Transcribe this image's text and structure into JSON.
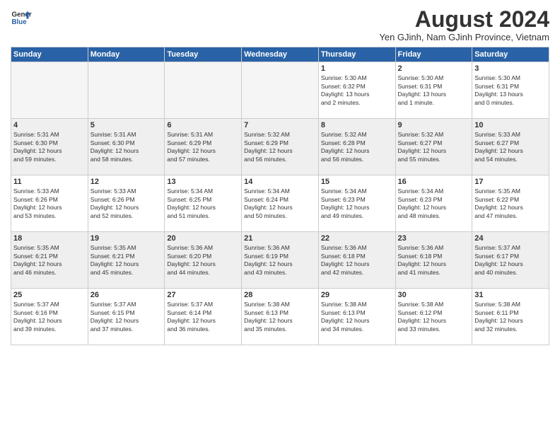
{
  "header": {
    "logo_line1": "General",
    "logo_line2": "Blue",
    "month_year": "August 2024",
    "location": "Yen GJinh, Nam GJinh Province, Vietnam"
  },
  "days_of_week": [
    "Sunday",
    "Monday",
    "Tuesday",
    "Wednesday",
    "Thursday",
    "Friday",
    "Saturday"
  ],
  "weeks": [
    [
      {
        "day": "",
        "info": ""
      },
      {
        "day": "",
        "info": ""
      },
      {
        "day": "",
        "info": ""
      },
      {
        "day": "",
        "info": ""
      },
      {
        "day": "1",
        "info": "Sunrise: 5:30 AM\nSunset: 6:32 PM\nDaylight: 13 hours\nand 2 minutes."
      },
      {
        "day": "2",
        "info": "Sunrise: 5:30 AM\nSunset: 6:31 PM\nDaylight: 13 hours\nand 1 minute."
      },
      {
        "day": "3",
        "info": "Sunrise: 5:30 AM\nSunset: 6:31 PM\nDaylight: 13 hours\nand 0 minutes."
      }
    ],
    [
      {
        "day": "4",
        "info": "Sunrise: 5:31 AM\nSunset: 6:30 PM\nDaylight: 12 hours\nand 59 minutes."
      },
      {
        "day": "5",
        "info": "Sunrise: 5:31 AM\nSunset: 6:30 PM\nDaylight: 12 hours\nand 58 minutes."
      },
      {
        "day": "6",
        "info": "Sunrise: 5:31 AM\nSunset: 6:29 PM\nDaylight: 12 hours\nand 57 minutes."
      },
      {
        "day": "7",
        "info": "Sunrise: 5:32 AM\nSunset: 6:29 PM\nDaylight: 12 hours\nand 56 minutes."
      },
      {
        "day": "8",
        "info": "Sunrise: 5:32 AM\nSunset: 6:28 PM\nDaylight: 12 hours\nand 56 minutes."
      },
      {
        "day": "9",
        "info": "Sunrise: 5:32 AM\nSunset: 6:27 PM\nDaylight: 12 hours\nand 55 minutes."
      },
      {
        "day": "10",
        "info": "Sunrise: 5:33 AM\nSunset: 6:27 PM\nDaylight: 12 hours\nand 54 minutes."
      }
    ],
    [
      {
        "day": "11",
        "info": "Sunrise: 5:33 AM\nSunset: 6:26 PM\nDaylight: 12 hours\nand 53 minutes."
      },
      {
        "day": "12",
        "info": "Sunrise: 5:33 AM\nSunset: 6:26 PM\nDaylight: 12 hours\nand 52 minutes."
      },
      {
        "day": "13",
        "info": "Sunrise: 5:34 AM\nSunset: 6:25 PM\nDaylight: 12 hours\nand 51 minutes."
      },
      {
        "day": "14",
        "info": "Sunrise: 5:34 AM\nSunset: 6:24 PM\nDaylight: 12 hours\nand 50 minutes."
      },
      {
        "day": "15",
        "info": "Sunrise: 5:34 AM\nSunset: 6:23 PM\nDaylight: 12 hours\nand 49 minutes."
      },
      {
        "day": "16",
        "info": "Sunrise: 5:34 AM\nSunset: 6:23 PM\nDaylight: 12 hours\nand 48 minutes."
      },
      {
        "day": "17",
        "info": "Sunrise: 5:35 AM\nSunset: 6:22 PM\nDaylight: 12 hours\nand 47 minutes."
      }
    ],
    [
      {
        "day": "18",
        "info": "Sunrise: 5:35 AM\nSunset: 6:21 PM\nDaylight: 12 hours\nand 46 minutes."
      },
      {
        "day": "19",
        "info": "Sunrise: 5:35 AM\nSunset: 6:21 PM\nDaylight: 12 hours\nand 45 minutes."
      },
      {
        "day": "20",
        "info": "Sunrise: 5:36 AM\nSunset: 6:20 PM\nDaylight: 12 hours\nand 44 minutes."
      },
      {
        "day": "21",
        "info": "Sunrise: 5:36 AM\nSunset: 6:19 PM\nDaylight: 12 hours\nand 43 minutes."
      },
      {
        "day": "22",
        "info": "Sunrise: 5:36 AM\nSunset: 6:18 PM\nDaylight: 12 hours\nand 42 minutes."
      },
      {
        "day": "23",
        "info": "Sunrise: 5:36 AM\nSunset: 6:18 PM\nDaylight: 12 hours\nand 41 minutes."
      },
      {
        "day": "24",
        "info": "Sunrise: 5:37 AM\nSunset: 6:17 PM\nDaylight: 12 hours\nand 40 minutes."
      }
    ],
    [
      {
        "day": "25",
        "info": "Sunrise: 5:37 AM\nSunset: 6:16 PM\nDaylight: 12 hours\nand 39 minutes."
      },
      {
        "day": "26",
        "info": "Sunrise: 5:37 AM\nSunset: 6:15 PM\nDaylight: 12 hours\nand 37 minutes."
      },
      {
        "day": "27",
        "info": "Sunrise: 5:37 AM\nSunset: 6:14 PM\nDaylight: 12 hours\nand 36 minutes."
      },
      {
        "day": "28",
        "info": "Sunrise: 5:38 AM\nSunset: 6:13 PM\nDaylight: 12 hours\nand 35 minutes."
      },
      {
        "day": "29",
        "info": "Sunrise: 5:38 AM\nSunset: 6:13 PM\nDaylight: 12 hours\nand 34 minutes."
      },
      {
        "day": "30",
        "info": "Sunrise: 5:38 AM\nSunset: 6:12 PM\nDaylight: 12 hours\nand 33 minutes."
      },
      {
        "day": "31",
        "info": "Sunrise: 5:38 AM\nSunset: 6:11 PM\nDaylight: 12 hours\nand 32 minutes."
      }
    ]
  ]
}
